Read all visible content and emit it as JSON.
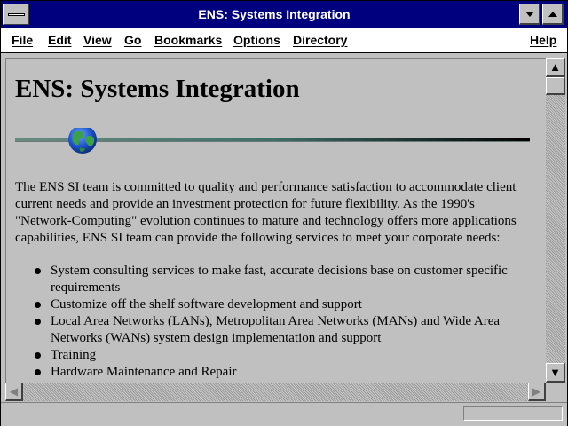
{
  "window": {
    "title": "ENS: Systems Integration"
  },
  "menu": {
    "file": "File",
    "edit": "Edit",
    "view": "View",
    "go": "Go",
    "bookmarks": "Bookmarks",
    "options": "Options",
    "directory": "Directory",
    "help": "Help"
  },
  "page": {
    "heading": "ENS: Systems Integration",
    "divider_icon": "globe-icon",
    "intro": "The ENS SI team is committed to quality and performance satisfaction to accommodate client current needs and provide an investment protection for future flexibility. As the 1990's \"Network-Computing\" evolution continues to mature and technology offers more applications capabilities, ENS SI team can provide the following services to meet your corporate needs:",
    "services": [
      "System consulting services to make fast, accurate decisions base on customer specific requirements",
      "Customize off the shelf software development and support",
      "Local Area Networks (LANs), Metropolitan Area Networks (MANs) and Wide Area Networks (WANs) system design implementation and support",
      "Training",
      "Hardware Maintenance and Repair"
    ]
  },
  "scrollbar": {
    "up_icon": "arrow-up-icon",
    "down_icon": "arrow-down-icon",
    "left_icon": "arrow-left-icon",
    "right_icon": "arrow-right-icon"
  },
  "status": {
    "text": ""
  },
  "colors": {
    "titlebar": "#00007e",
    "window": "#c0c0c0",
    "menubar": "#ffffff"
  }
}
